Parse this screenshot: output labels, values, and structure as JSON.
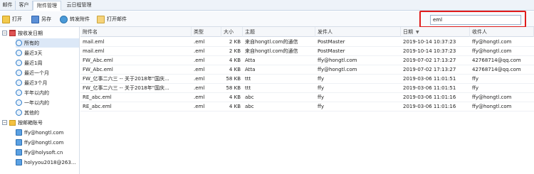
{
  "tabs": [
    "邮件",
    "客户",
    "附件管理",
    "云日程管理"
  ],
  "toolbar": {
    "open": "打开",
    "save_as": "另存",
    "forward_attachment": "转发附件",
    "open_mail": "打开邮件"
  },
  "search": {
    "value": "eml"
  },
  "sidebar": {
    "date_group": "按收发日期",
    "date_items": [
      "所有的",
      "最近3天",
      "最近1周",
      "最近一个月",
      "最近3个月",
      "半年以内的",
      "一年以内的",
      "其他的"
    ],
    "account_group": "按邮箱账号",
    "accounts": [
      "ffy@hongtl.com",
      "ffy@hongtl.com",
      "ffy@holysoft.cn",
      "holyyou2018@263..."
    ]
  },
  "table": {
    "columns": [
      "附件名",
      "类型",
      "大小",
      "主题",
      "发件人",
      "日期",
      "收件人"
    ],
    "rows": [
      [
        "mail.eml",
        ".eml",
        "2 KB",
        "来自hongtl.com的通信",
        "PostMaster",
        "2019-10-14 10:37:23",
        "ffy@hongtl.com"
      ],
      [
        "mail.eml",
        ".eml",
        "2 KB",
        "来自hongtl.com的通信",
        "PostMaster",
        "2019-10-14 10:37:23",
        "ffy@hongtl.com"
      ],
      [
        "FW_Abc.eml",
        ".eml",
        "4 KB",
        "Atta",
        "ffy@hongtl.com",
        "2019-07-02 17:13:27",
        "42768714@qq.com"
      ],
      [
        "FW_Abc.eml",
        ".eml",
        "4 KB",
        "Atta",
        "ffy@hongtl.com",
        "2019-07-02 17:13:27",
        "42768714@qq.com"
      ],
      [
        "FW_亿事二六三 -- 关于2018年\"国庆...",
        ".eml",
        "58 KB",
        "ttt",
        "ffy",
        "2019-03-06 11:01:51",
        "ffy"
      ],
      [
        "FW_亿事二六三 -- 关于2018年\"国庆...",
        ".eml",
        "58 KB",
        "ttt",
        "ffy",
        "2019-03-06 11:01:51",
        "ffy"
      ],
      [
        "RE_abc.eml",
        ".eml",
        "4 KB",
        "abc",
        "ffy",
        "2019-03-06 11:01:16",
        "ffy@hongtl.com"
      ],
      [
        "RE_abc.eml",
        ".eml",
        "4 KB",
        "abc",
        "ffy",
        "2019-03-06 11:01:16",
        "ffy@hongtl.com"
      ]
    ]
  }
}
